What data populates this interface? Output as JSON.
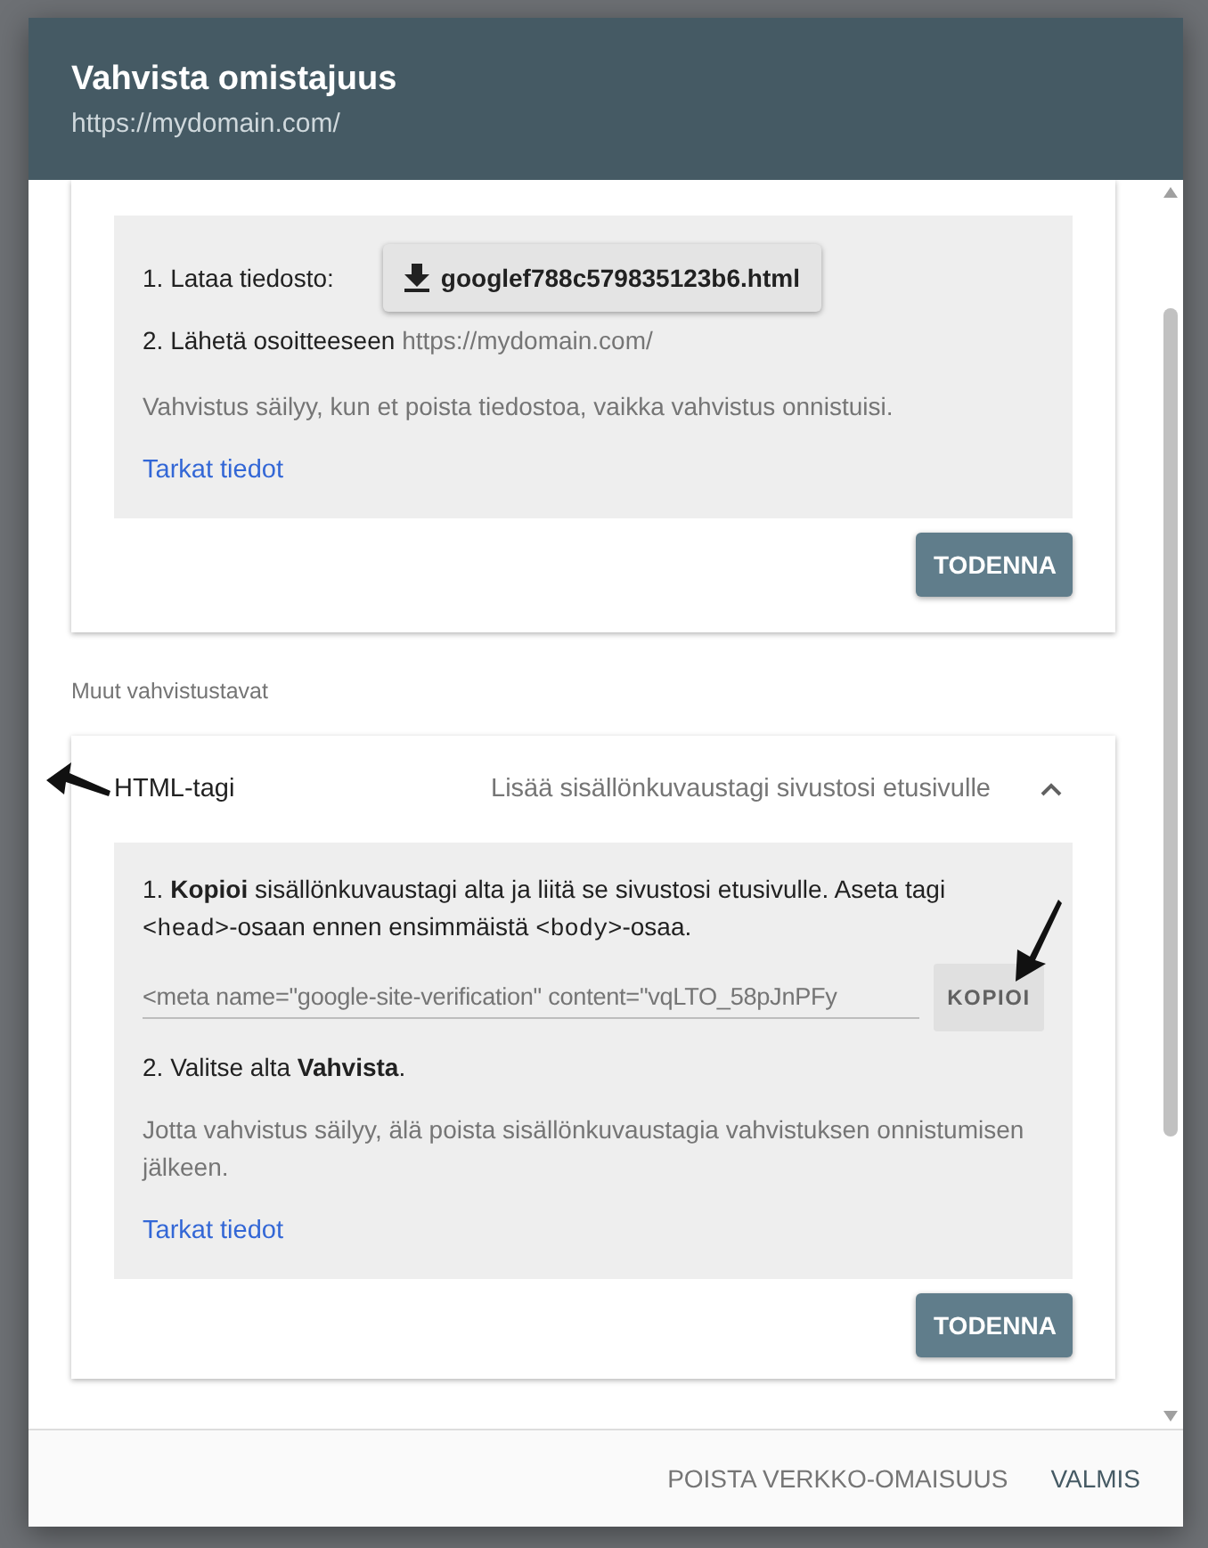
{
  "window": {
    "title": "Vahvista omistajuus",
    "subtitle": "https://mydomain.com/"
  },
  "file_card": {
    "download_label": "1. Lataa tiedosto:",
    "download_button": "googlef788c579835123b6.html",
    "upload_label": "2. Lähetä osoitteeseen",
    "upload_url": "https://mydomain.com/",
    "note": "Vahvistus säilyy, kun et poista tiedostoa, vaikka vahvistus onnistuisi.",
    "link": "Tarkat tiedot",
    "verify_button": "TODENNA"
  },
  "other_methods_heading": "Muut vahvistustavat",
  "methods": [
    {
      "title": "HTML-tagi",
      "description": "Lisää sisällönkuvaustagi sivustosi etusivulle",
      "expanded": true,
      "instruction_parts": [
        {
          "kind": "text",
          "text": "1. **Kopioi** sisällönkuvaustagi alta ja liitä se sivustosi etusivulle. Aseta tagi "
        },
        {
          "kind": "code",
          "text": "<head>"
        },
        {
          "kind": "text",
          "text": "-osaan ennen ensimmäistä "
        },
        {
          "kind": "code",
          "text": "<body>"
        },
        {
          "kind": "text",
          "text": "-osaa."
        }
      ],
      "tag_value": "<meta name=\"google-site-verification\" content=\"vqLTO_58pJnPFy",
      "copy_button": "KOPIOI",
      "step2": "2. Valitse alta **Vahvista**.",
      "note": "Jotta vahvistus säilyy, älä poista sisällönkuvaustagia vahvistuksen onnistumisen jälkeen.",
      "link": "Tarkat tiedot",
      "verify_button": "TODENNA"
    }
  ],
  "footer": {
    "buttons": [
      {
        "label": "POISTA VERKKO-OMAISUUS",
        "kind": "secondary"
      },
      {
        "label": "VALMIS",
        "kind": "primary"
      }
    ]
  }
}
